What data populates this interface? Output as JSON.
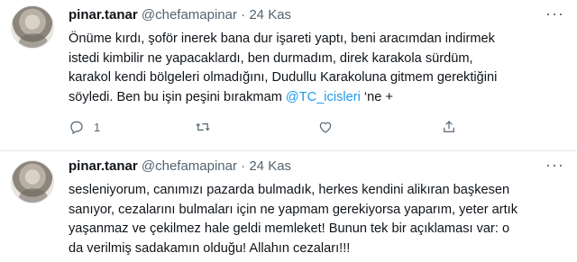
{
  "tweets": [
    {
      "name": "pinar.tanar",
      "handle": "@chefamapinar",
      "separator": "·",
      "time": "24 Kas",
      "more_icon": "more-horizontal-icon",
      "lines": [
        "Önüme kırdı, şoför inerek bana dur işareti yaptı, beni aracımdan indirmek",
        "istedi kimbilir ne yapacaklardı, ben durmadım, direk karakola sürdüm,",
        "karakol kendi bölgeleri olmadığını, Dudullu Karakoluna gitmem gerektiğini"
      ],
      "last_line_prefix": "söyledi. Ben bu işin peşini bırakmam ",
      "mention": "@TC_icisleri",
      "last_line_suffix": " ‘ne +",
      "reply_count": "1",
      "retweet_count": "",
      "like_count": "",
      "icons": {
        "reply": "reply-icon",
        "retweet": "retweet-icon",
        "like": "like-icon",
        "share": "share-icon"
      }
    },
    {
      "name": "pinar.tanar",
      "handle": "@chefamapinar",
      "separator": "·",
      "time": "24 Kas",
      "more_icon": "more-horizontal-icon",
      "lines": [
        "sesleniyorum, canımızı pazarda bulmadık, herkes kendini alikıran başkesen",
        "sanıyor, cezalarını bulmaları için ne yapmam gerekiyorsa yaparım, yeter artık",
        "yaşanmaz ve çekilmez hale geldi memleket! Bunun tek bir açıklaması var: o",
        "da verilmiş sadakamın olduğu! Allahın cezaları!!!"
      ]
    }
  ],
  "colors": {
    "text": "#0f1419",
    "secondary": "#536471",
    "accent": "#1d9bf0",
    "divider": "#e6ebee"
  }
}
